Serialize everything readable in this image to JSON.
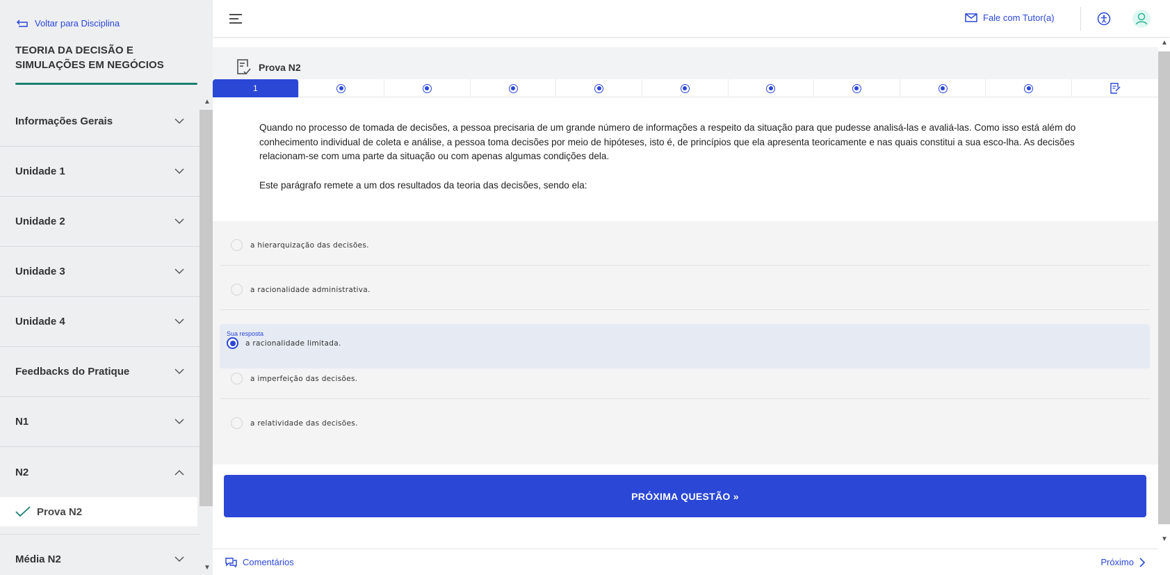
{
  "sidebar": {
    "back_label": "Voltar para Disciplina",
    "course_title": "TEORIA DA DECISÃO E SIMULAÇÕES EM NEGÓCIOS",
    "items": [
      {
        "label": "Informações Gerais"
      },
      {
        "label": "Unidade 1"
      },
      {
        "label": "Unidade 2"
      },
      {
        "label": "Unidade 3"
      },
      {
        "label": "Unidade 4"
      },
      {
        "label": "Feedbacks do Pratique"
      },
      {
        "label": "N1"
      },
      {
        "label": "N2"
      },
      {
        "label": "Média N2"
      }
    ],
    "sub_item": {
      "label": "Prova N2"
    }
  },
  "header": {
    "tutor_label": "Fale com Tutor(a)"
  },
  "exam": {
    "title": "Prova N2",
    "active_question": "1",
    "question_paragraphs": [
      "Quando no processo de tomada de decisões, a pessoa precisaria de um grande número de informações a respeito da situação para que pudesse analisá-las e avaliá-las. Como isso está além do conhecimento individual de coleta e análise, a pessoa toma decisões por meio de hipóteses, isto é, de princípios que ela apresenta teoricamente e nas quais constitui a sua esco-lha. As decisões relacionam-se com uma parte da situação ou com apenas algumas condições dela.",
      "Este parágrafo remete a um dos resultados da teoria das decisões, sendo ela:"
    ],
    "your_answer_label": "Sua resposta",
    "options": [
      {
        "text": "a hierarquização das decisões.",
        "selected": false
      },
      {
        "text": "a racionalidade administrativa.",
        "selected": false
      },
      {
        "text": "a racionalidade limitada.",
        "selected": true
      },
      {
        "text": "a imperfeição das decisões.",
        "selected": false
      },
      {
        "text": "a relatividade das decisões.",
        "selected": false
      }
    ],
    "next_button": "PRÓXIMA QUESTÃO »"
  },
  "footer": {
    "comments_label": "Comentários",
    "next_label": "Próximo"
  },
  "colors": {
    "accent": "#2a47d6",
    "teal_rule": "#1a7f70",
    "sidebar_bg": "#eeeff1",
    "selected_bg": "#e6ebf3"
  }
}
